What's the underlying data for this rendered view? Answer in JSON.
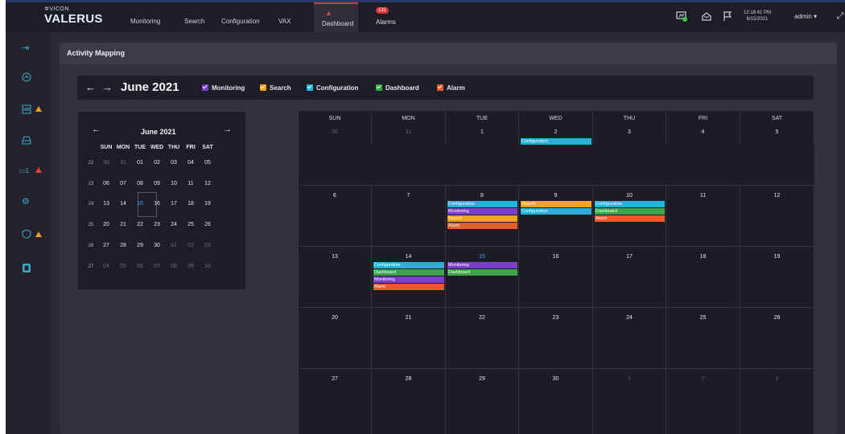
{
  "brand": {
    "company": "VICON",
    "product": "VALERUS"
  },
  "nav": {
    "monitoring": "Monitoring",
    "search": "Search",
    "configuration": "Configuration",
    "vax": "VAX"
  },
  "tabs": {
    "dashboard": "Dashboard",
    "alarms": "Alarms",
    "alarm_count": "131"
  },
  "status": {
    "time": "12:18:41 PM",
    "date": "6/15/2021",
    "user": "admin ▾"
  },
  "panel_title": "Activity Mapping",
  "toolbar": {
    "month": "June 2021",
    "legend": [
      {
        "label": "Monitoring",
        "color": "#7b3fd0"
      },
      {
        "label": "Search",
        "color": "#f2a21b"
      },
      {
        "label": "Configuration",
        "color": "#1fb5d8"
      },
      {
        "label": "Dashboard",
        "color": "#3fa34a"
      },
      {
        "label": "Alarm",
        "color": "#ef5a2a"
      }
    ]
  },
  "colors": {
    "monitoring": "#7b3fd0",
    "search": "#f2a21b",
    "configuration": "#1fb5d8",
    "dashboard": "#3fa34a",
    "alarm": "#ef5a2a"
  },
  "mini": {
    "title": "June 2021",
    "days": [
      "SUN",
      "MON",
      "TUE",
      "WED",
      "THU",
      "FRI",
      "SAT"
    ],
    "weeks": [
      {
        "wk": "22",
        "d": [
          "30",
          "31",
          "01",
          "02",
          "03",
          "04",
          "05"
        ]
      },
      {
        "wk": "23",
        "d": [
          "06",
          "07",
          "08",
          "09",
          "10",
          "11",
          "12"
        ]
      },
      {
        "wk": "24",
        "d": [
          "13",
          "14",
          "15",
          "16",
          "17",
          "18",
          "19"
        ]
      },
      {
        "wk": "25",
        "d": [
          "20",
          "21",
          "22",
          "23",
          "24",
          "25",
          "26"
        ]
      },
      {
        "wk": "26",
        "d": [
          "27",
          "28",
          "29",
          "30",
          "01",
          "02",
          "03"
        ]
      },
      {
        "wk": "27",
        "d": [
          "04",
          "05",
          "06",
          "07",
          "08",
          "09",
          "10"
        ]
      }
    ]
  },
  "calendar": {
    "days": [
      "SUN",
      "MON",
      "TUE",
      "WED",
      "THU",
      "FRI",
      "SAT"
    ],
    "weeks": [
      [
        "30",
        "31",
        "1",
        "2",
        "3",
        "4",
        "5"
      ],
      [
        "6",
        "7",
        "8",
        "9",
        "10",
        "11",
        "12"
      ],
      [
        "13",
        "14",
        "15",
        "16",
        "17",
        "18",
        "19"
      ],
      [
        "20",
        "21",
        "22",
        "23",
        "24",
        "25",
        "26"
      ],
      [
        "27",
        "28",
        "29",
        "30",
        "1",
        "2",
        "3"
      ]
    ],
    "events": {
      "0-3": [
        "Configuration"
      ],
      "1-2": [
        "Configuration",
        "Monitoring",
        "Search",
        "Alarm"
      ],
      "1-3": [
        "Search",
        "Configuration"
      ],
      "1-4": [
        "Configuration",
        "Dashboard",
        "Alarm"
      ],
      "2-1": [
        "Configuration",
        "Dashboard",
        "Monitoring",
        "Alarm"
      ],
      "2-2": [
        "Monitoring",
        "Dashboard"
      ]
    }
  }
}
